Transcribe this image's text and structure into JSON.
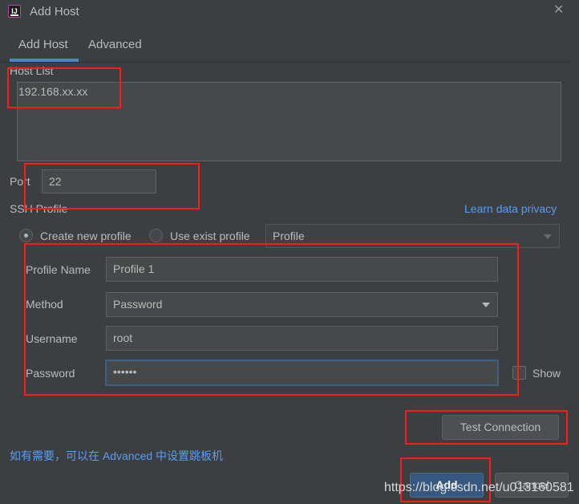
{
  "window": {
    "title": "Add Host",
    "close_icon": "close-icon",
    "app_icon": "intellij-app-icon"
  },
  "tabs": [
    {
      "label": "Add Host",
      "selected": true
    },
    {
      "label": "Advanced",
      "selected": false
    }
  ],
  "host_list": {
    "label": "Host List",
    "value": "192.168.xx.xx"
  },
  "port": {
    "label": "Port",
    "value": "22"
  },
  "ssh_profile": {
    "label": "SSH Profile",
    "privacy_link": "Learn data privacy",
    "create_option": "Create new profile",
    "use_option": "Use exist profile",
    "selected_option": "create",
    "profile_select_value": "Profile"
  },
  "profile_form": {
    "name_label": "Profile Name",
    "name_value": "Profile 1",
    "method_label": "Method",
    "method_value": "Password",
    "username_label": "Username",
    "username_value": "root",
    "password_label": "Password",
    "password_value": "••••••",
    "show_label": "Show",
    "show_checked": false
  },
  "buttons": {
    "test_connection": "Test Connection",
    "add": "Add",
    "cancel": "Cancel"
  },
  "hint_text": "如有需要，可以在 Advanced 中设置跳板机",
  "watermark": "https://blog.csdn.net/u013160581",
  "colors": {
    "background": "#3c3f41",
    "accent": "#4a88c7",
    "link": "#589df6",
    "annotation": "#ff1a1a",
    "default_button": "#365880"
  }
}
